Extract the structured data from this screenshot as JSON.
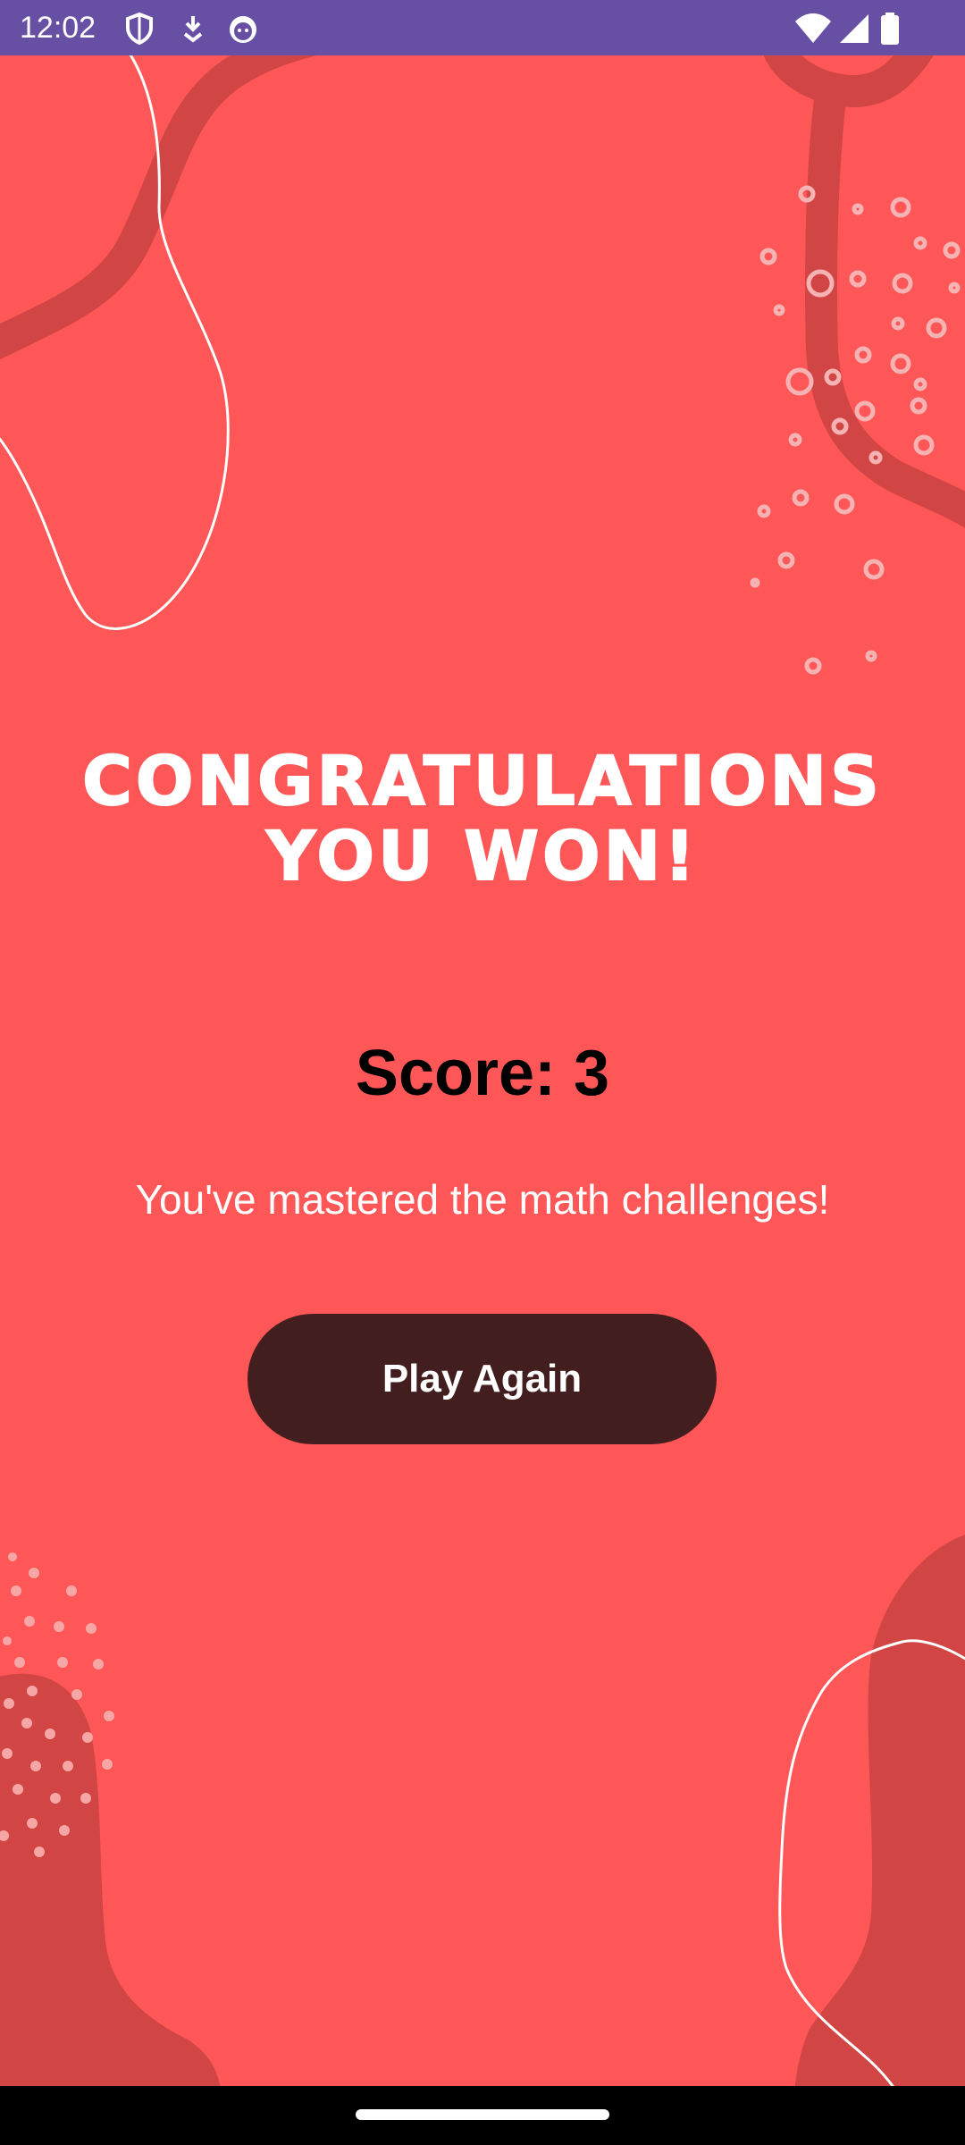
{
  "status_bar": {
    "time": "12:02",
    "left_icons": [
      "shield-icon",
      "download-icon",
      "android-face-icon"
    ],
    "right_icons": [
      "wifi-icon",
      "signal-icon",
      "battery-icon"
    ]
  },
  "game_over": {
    "title": "Congratulations\nYou Won!",
    "score_text": "Score: 3",
    "message": "You've mastered the math challenges!",
    "play_again_label": "Play Again"
  },
  "colors": {
    "status_bar": "#6750a4",
    "background": "#ff5757",
    "blob": "#d14545",
    "button": "#421e1f",
    "text_light": "#ffffff",
    "text_dark": "#000000"
  }
}
